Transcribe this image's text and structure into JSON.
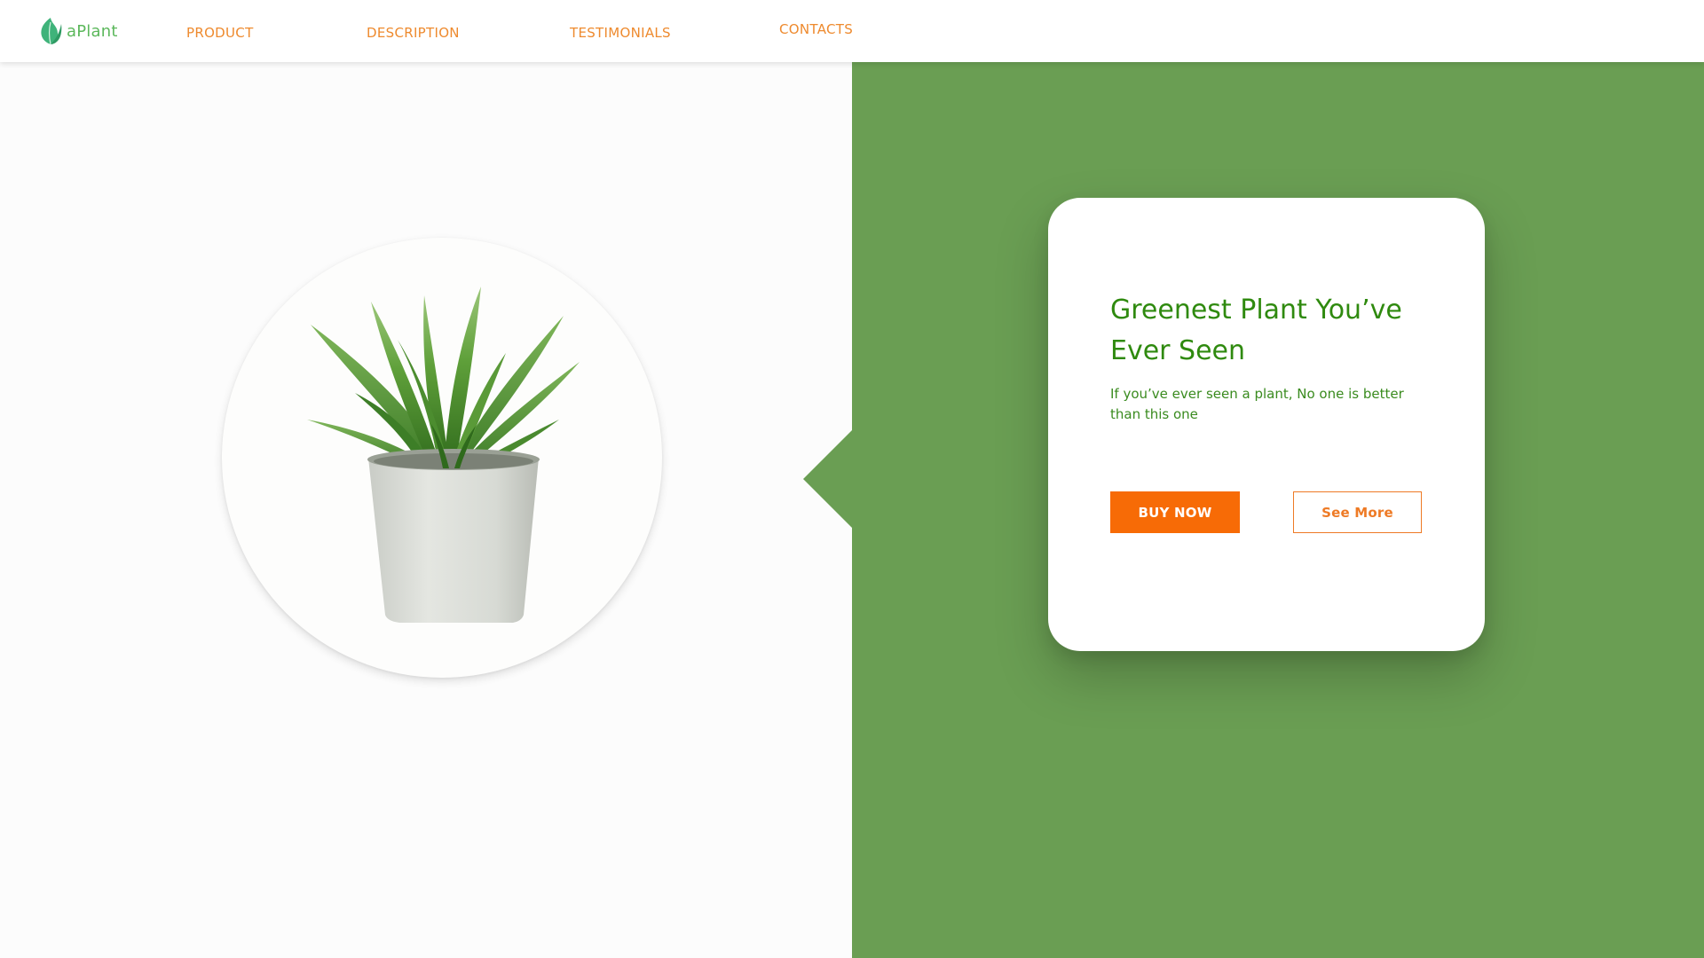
{
  "brand": {
    "name": "aPlant",
    "logo_icon": "leaf-icon",
    "color": "#5cb85c"
  },
  "nav": {
    "items": [
      {
        "label": "PRODUCT"
      },
      {
        "label": "DESCRIPTION"
      },
      {
        "label": "TESTIMONIALS"
      },
      {
        "label": "CONTACTS"
      }
    ],
    "color": "#ee8a2e"
  },
  "hero": {
    "image": "potted-aloe-plant",
    "panel_color": "#6a9e53"
  },
  "card": {
    "title": "Greenest Plant You’ve Ever Seen",
    "description": "If you’ve ever seen a plant, No one is better than this one",
    "buy_label": "BUY NOW",
    "more_label": "See More",
    "title_color": "#2f8a0f",
    "accent_color": "#f76b06"
  }
}
